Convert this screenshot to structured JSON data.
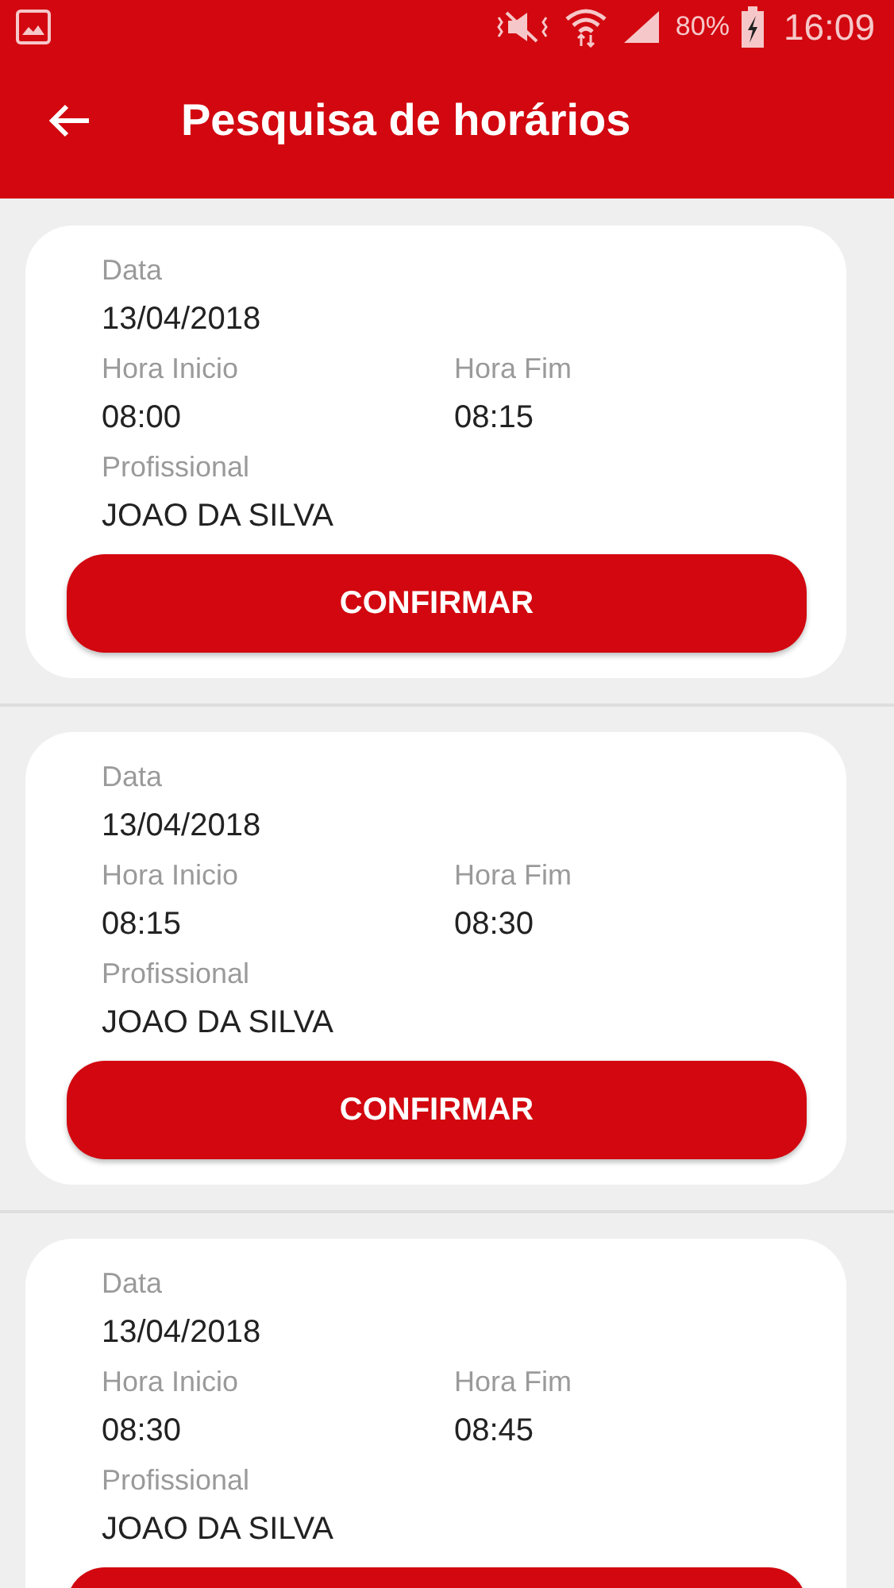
{
  "status_bar": {
    "battery": "80%",
    "time": "16:09"
  },
  "app_bar": {
    "title": "Pesquisa de horários"
  },
  "cards": [
    {
      "date_label": "Data",
      "date": "13/04/2018",
      "start_label": "Hora Inicio",
      "start": "08:00",
      "end_label": "Hora Fim",
      "end": "08:15",
      "professional_label": "Profissional",
      "professional": "JOAO DA SILVA",
      "button": "CONFIRMAR"
    },
    {
      "date_label": "Data",
      "date": "13/04/2018",
      "start_label": "Hora Inicio",
      "start": "08:15",
      "end_label": "Hora Fim",
      "end": "08:30",
      "professional_label": "Profissional",
      "professional": "JOAO DA SILVA",
      "button": "CONFIRMAR"
    },
    {
      "date_label": "Data",
      "date": "13/04/2018",
      "start_label": "Hora Inicio",
      "start": "08:30",
      "end_label": "Hora Fim",
      "end": "08:45",
      "professional_label": "Profissional",
      "professional": "JOAO DA SILVA"
    }
  ]
}
